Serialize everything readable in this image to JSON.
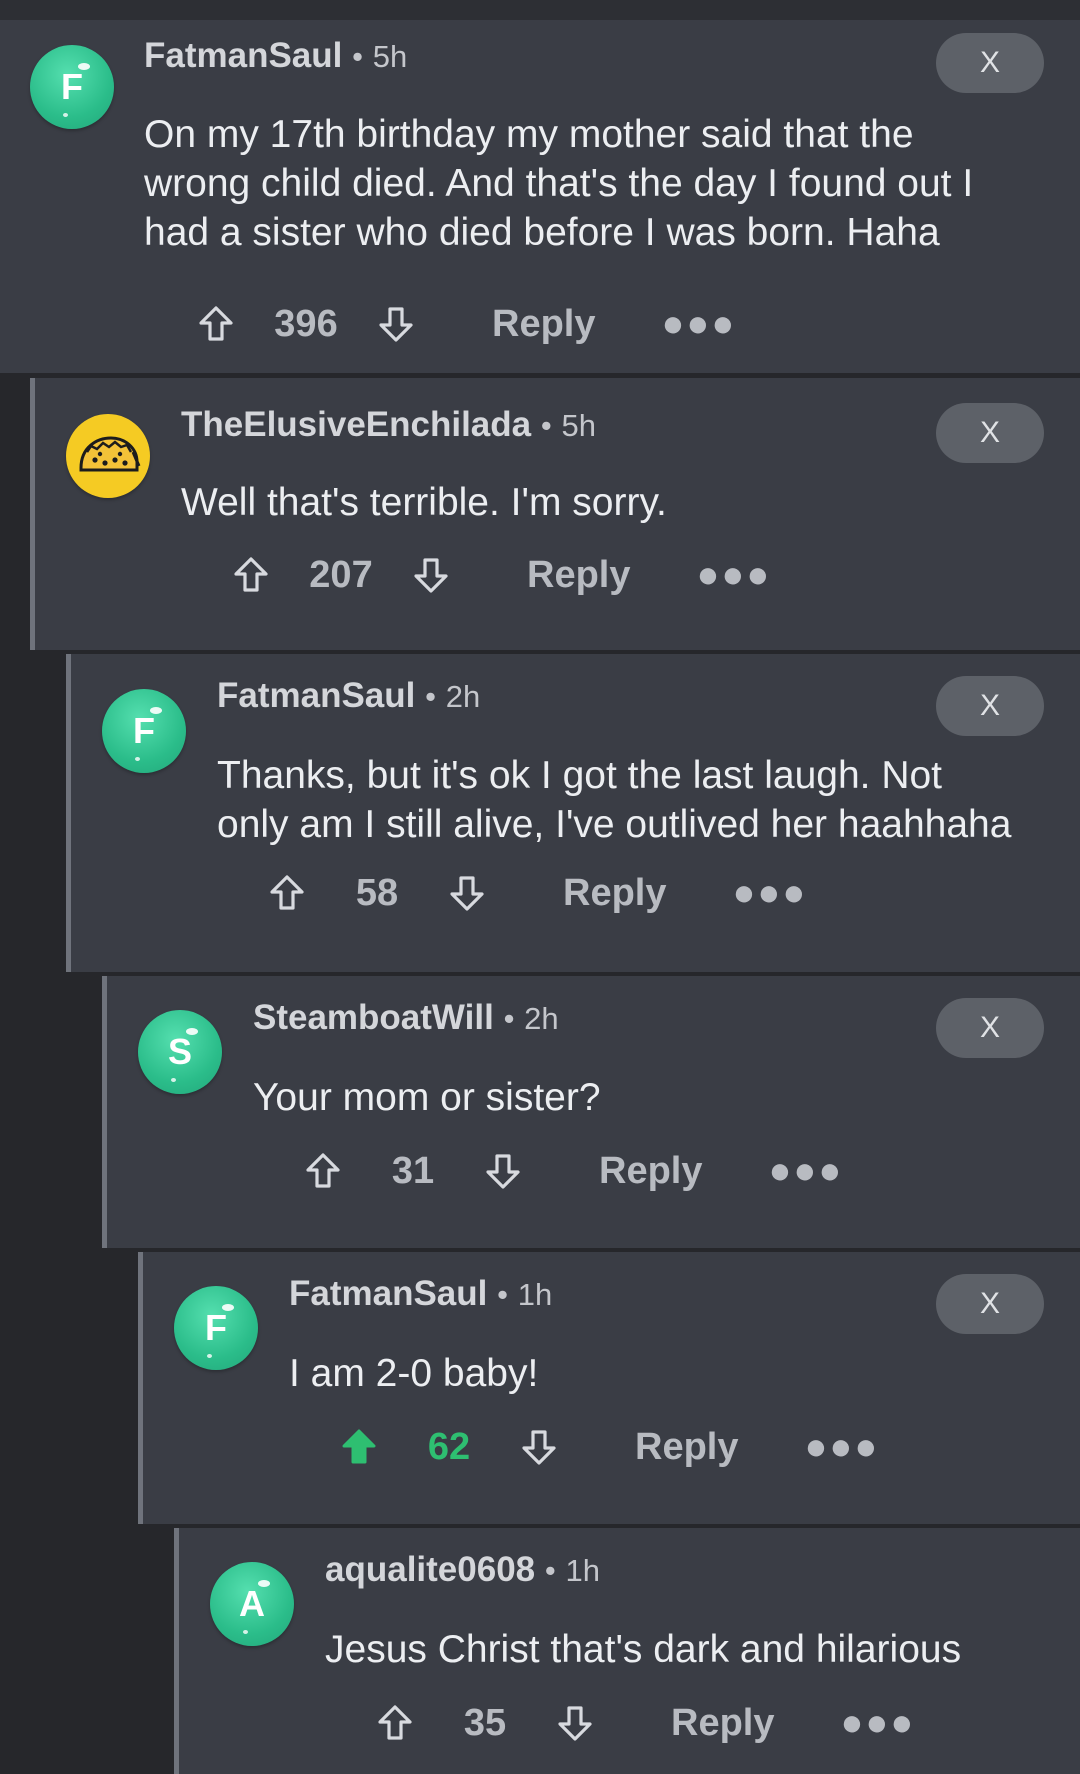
{
  "close_label": "X",
  "reply_label": "Reply",
  "separator": "•",
  "colors": {
    "background": "#26272b",
    "card": "#3a3d45",
    "avatar_green": "#2bbd8a",
    "taco_avatar": "#f5cb23",
    "upvoted": "#2ebf71"
  },
  "comments": [
    {
      "avatar_letter": "F",
      "avatar_type": "green-letter",
      "username": "FatmanSaul",
      "age": "5h",
      "text": "On my 17th birthday my mother said that the\nwrong child died. And that's the day I found out I\nhad a sister who died before I was born. Haha",
      "score": "396",
      "upvoted": false
    },
    {
      "avatar_letter": "",
      "avatar_type": "taco-icon",
      "username": "TheElusiveEnchilada",
      "age": "5h",
      "text": "Well that's terrible. I'm sorry.",
      "score": "207",
      "upvoted": false
    },
    {
      "avatar_letter": "F",
      "avatar_type": "green-letter",
      "username": "FatmanSaul",
      "age": "2h",
      "text": "Thanks, but it's ok I got the last laugh. Not\nonly am I still alive, I've outlived her haahhaha",
      "score": "58",
      "upvoted": false
    },
    {
      "avatar_letter": "S",
      "avatar_type": "green-letter",
      "username": "SteamboatWill",
      "age": "2h",
      "text": "Your mom or sister?",
      "score": "31",
      "upvoted": false
    },
    {
      "avatar_letter": "F",
      "avatar_type": "green-letter",
      "username": "FatmanSaul",
      "age": "1h",
      "text": "I am 2-0 baby!",
      "score": "62",
      "upvoted": true
    },
    {
      "avatar_letter": "A",
      "avatar_type": "green-letter",
      "username": "aqualite0608",
      "age": "1h",
      "text": "Jesus Christ that's dark and hilarious",
      "score": "35",
      "upvoted": false
    }
  ]
}
